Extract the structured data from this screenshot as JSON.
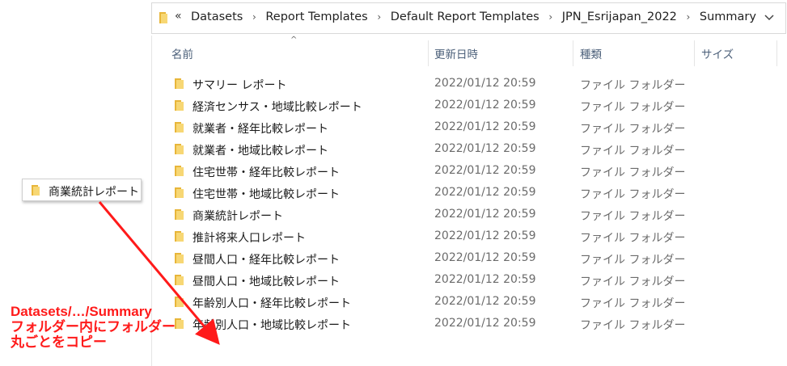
{
  "address_bar": {
    "overflow": "«",
    "breadcrumbs": [
      "Datasets",
      "Report Templates",
      "Default Report Templates",
      "JPN_Esrijapan_2022",
      "Summary"
    ],
    "separator": "›"
  },
  "columns": {
    "name": "名前",
    "modified": "更新日時",
    "type": "種類",
    "size": "サイズ",
    "sort_indicator": "^"
  },
  "files": [
    {
      "name": "サマリー レポート",
      "modified": "2022/01/12 20:59",
      "type": "ファイル フォルダー"
    },
    {
      "name": "経済センサス・地域比較レポート",
      "modified": "2022/01/12 20:59",
      "type": "ファイル フォルダー"
    },
    {
      "name": "就業者・経年比較レポート",
      "modified": "2022/01/12 20:59",
      "type": "ファイル フォルダー"
    },
    {
      "name": "就業者・地域比較レポート",
      "modified": "2022/01/12 20:59",
      "type": "ファイル フォルダー"
    },
    {
      "name": "住宅世帯・経年比較レポート",
      "modified": "2022/01/12 20:59",
      "type": "ファイル フォルダー"
    },
    {
      "name": "住宅世帯・地域比較レポート",
      "modified": "2022/01/12 20:59",
      "type": "ファイル フォルダー"
    },
    {
      "name": "商業統計レポート",
      "modified": "2022/01/12 20:59",
      "type": "ファイル フォルダー"
    },
    {
      "name": "推計将来人口レポート",
      "modified": "2022/01/12 20:59",
      "type": "ファイル フォルダー"
    },
    {
      "name": "昼間人口・経年比較レポート",
      "modified": "2022/01/12 20:59",
      "type": "ファイル フォルダー"
    },
    {
      "name": "昼間人口・地域比較レポート",
      "modified": "2022/01/12 20:59",
      "type": "ファイル フォルダー"
    },
    {
      "name": "年齢別人口・経年比較レポート",
      "modified": "2022/01/12 20:59",
      "type": "ファイル フォルダー"
    },
    {
      "name": "年齢別人口・地域比較レポート",
      "modified": "2022/01/12 20:59",
      "type": "ファイル フォルダー"
    }
  ],
  "drag_item": {
    "label": "商業統計レポート",
    "icon": "folder-icon"
  },
  "annotation": {
    "lines": [
      "Datasets/…/Summary",
      "フォルダー内にフォルダー",
      "丸ごとをコピー"
    ],
    "color": "#ff1a1a"
  },
  "colors": {
    "folder": "#e8b63a",
    "folder_light": "#f7d774",
    "header_text": "#4c607a",
    "muted_text": "#6b6b6b"
  }
}
